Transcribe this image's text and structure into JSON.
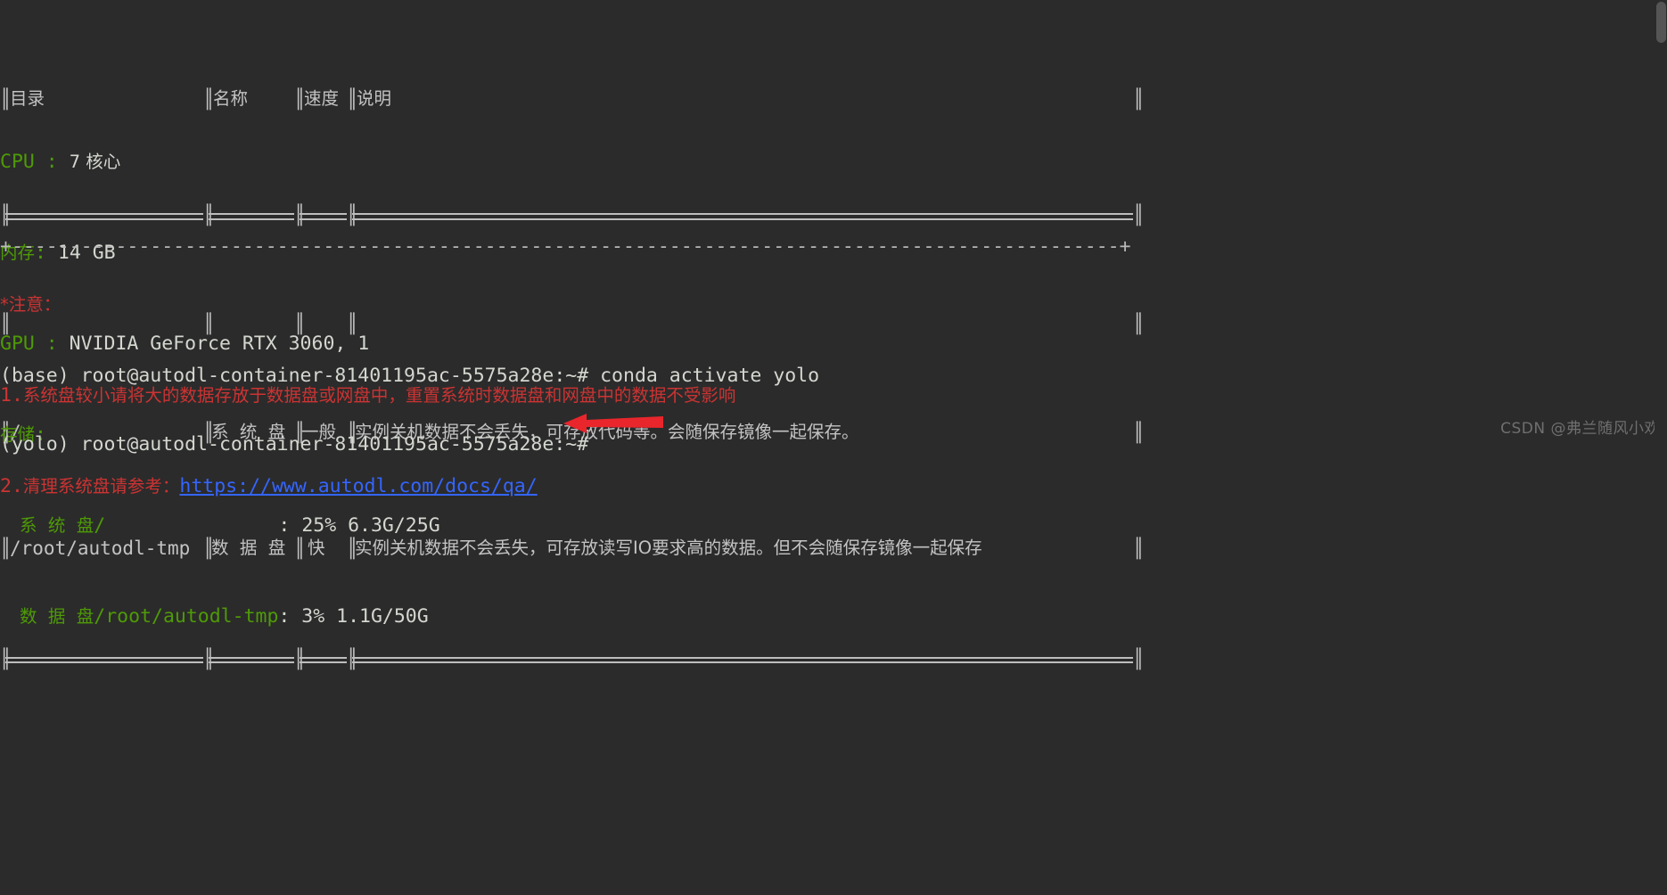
{
  "terminal": {
    "background_color": "#2b2b2b",
    "foreground_color": "#d3d7cf",
    "green_color": "#4e9a06",
    "red_color": "#cc3333",
    "link_color": "#3465ff"
  },
  "disk_table": {
    "headers": [
      "目录",
      "名称",
      "速度",
      "说明"
    ],
    "rows": [
      {
        "path": "/",
        "name": "系  统  盘",
        "speed": "一般",
        "desc": "实例关机数据不会丢失，可存放代码等。会随保存镜像一起保存。"
      },
      {
        "path": "/root/autodl-tmp",
        "name": "数  据  盘",
        "speed": "快",
        "desc": "实例关机数据不会丢失，可存放读写IO要求高的数据。但不会随保存镜像一起保存"
      }
    ]
  },
  "system_info": {
    "cpu_label": "CPU ",
    "cpu_sep": ": ",
    "cpu_value": "7 核心",
    "mem_label": "内存",
    "mem_sep": ": ",
    "mem_value": "14 GB",
    "gpu_label": "GPU ",
    "gpu_sep": ": ",
    "gpu_value": "NVIDIA GeForce RTX 3060, 1",
    "storage_label": "存储",
    "storage_sep": ":",
    "disks": [
      {
        "name": "系  统  盘",
        "mount": "/",
        "pad": "               ",
        "sep": ": ",
        "usage": "25% 6.3G/25G"
      },
      {
        "name": "数  据  盘",
        "mount": "/root/autodl-tmp",
        "pad": "",
        "sep": ": ",
        "usage": "3% 1.1G/50G"
      }
    ]
  },
  "separator": "+------------------------------------------------------------------------------------------------+",
  "notice": {
    "title": "*注意：",
    "items": [
      {
        "number": "1.",
        "text": "系统盘较小请将大的数据存放于数据盘或网盘中，重置系统时数据盘和网盘中的数据不受影响"
      },
      {
        "number": "2.",
        "text": "清理系统盘请参考：",
        "link": "https://www.autodl.com/docs/qa/"
      }
    ]
  },
  "prompt_lines": [
    {
      "env": "(base)",
      "prompt": " root@autodl-container-81401195ac-5575a28e:~# ",
      "command": "conda activate yolo"
    },
    {
      "env": "(yolo)",
      "prompt": " root@autodl-container-81401195ac-5575a28e:~# ",
      "command": ""
    }
  ],
  "annotation": {
    "arrow_name": "red-left-arrow",
    "arrow_color": "#e8262b"
  },
  "watermark": "CSDN @弗兰随风小欢"
}
